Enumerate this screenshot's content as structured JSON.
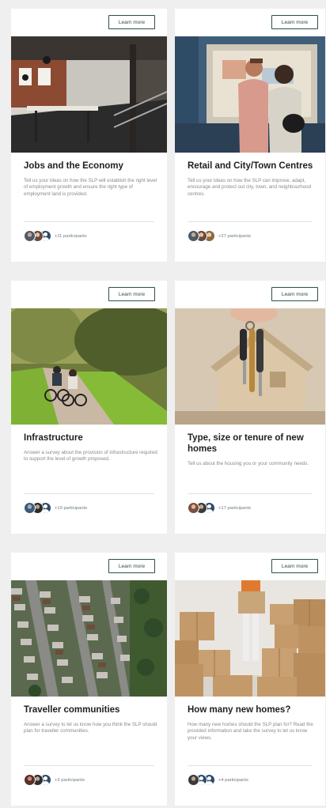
{
  "cards": [
    {
      "button": "Learn more",
      "title": "Jobs and the Economy",
      "description": "Tell us your ideas on how the SLP will establish the right level of employment growth and ensure the right type of employment land is provided.",
      "participants": "+11 participants",
      "image": "office-photo"
    },
    {
      "button": "Learn more",
      "title": "Retail and City/Town Centres",
      "description": "Tell us your ideas on how the SLP can improve, adapt, encourage and protect out city, town, and neighbourhood centres.",
      "participants": "+27 participants",
      "image": "shopping-couple-photo"
    },
    {
      "button": "Learn more",
      "title": "Infrastructure",
      "description": "Answer a survey about the provision of infrastructure required to support the level of growth proposed.",
      "participants": "+19 participants",
      "image": "cyclists-path-photo"
    },
    {
      "button": "Learn more",
      "title": "Type, size or tenure of new homes",
      "description": "Tell us about the housing you or your community needs.",
      "participants": "+17 participants",
      "image": "house-keys-photo"
    },
    {
      "button": "Learn more",
      "title": "Traveller communities",
      "description": "Answer a survey to let us know how you think the SLP should plan for traveller communities.",
      "participants": "+3 participants",
      "image": "aerial-housing-photo"
    },
    {
      "button": "Learn more",
      "title": "How many new homes?",
      "description": "How many new homes should the SLP plan for? Read the provided information and take the survey to let us know your views.",
      "participants": "+4 participants",
      "image": "moving-boxes-photo"
    }
  ],
  "colors": {
    "page_background": "#efefef",
    "card_background": "#ffffff",
    "button_border": "#2c4f4a",
    "title_text": "#1f1f1f",
    "description_text": "#8a8a8a"
  }
}
